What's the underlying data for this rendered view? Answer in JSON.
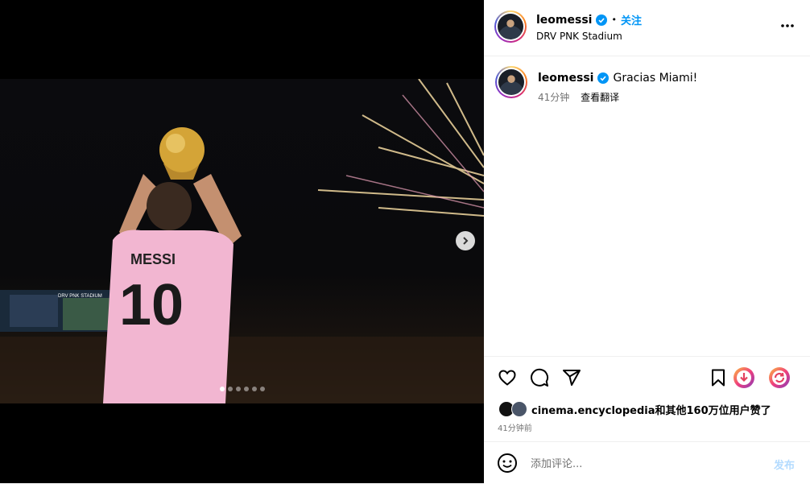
{
  "post": {
    "username": "leomessi",
    "follow_label": "关注",
    "separator": "•",
    "location": "DRV PNK Stadium",
    "caption": "Gracias Miami!",
    "caption_time": "41分钟",
    "translate_label": "查看翻译",
    "likes_text": "cinema.encyclopedia和其他160万位用户赞了",
    "posted_time": "41分钟前",
    "comment_placeholder": "添加评论...",
    "post_label": "发布",
    "carousel": {
      "slide_count": 6,
      "active_index": 0
    },
    "image_text": {
      "jersey_name": "MESSI",
      "jersey_number": "10",
      "stadium_sign": "DRV PNK STADIUM"
    }
  },
  "colors": {
    "accent": "#0095f6",
    "verified": "#0095f6",
    "text_secondary": "#737373",
    "post_disabled": "#b3dbff"
  },
  "icons": [
    "verified-badge-icon",
    "more-options-icon",
    "chevron-right-icon",
    "heart-icon",
    "comment-icon",
    "share-icon",
    "bookmark-icon",
    "emoji-icon"
  ]
}
